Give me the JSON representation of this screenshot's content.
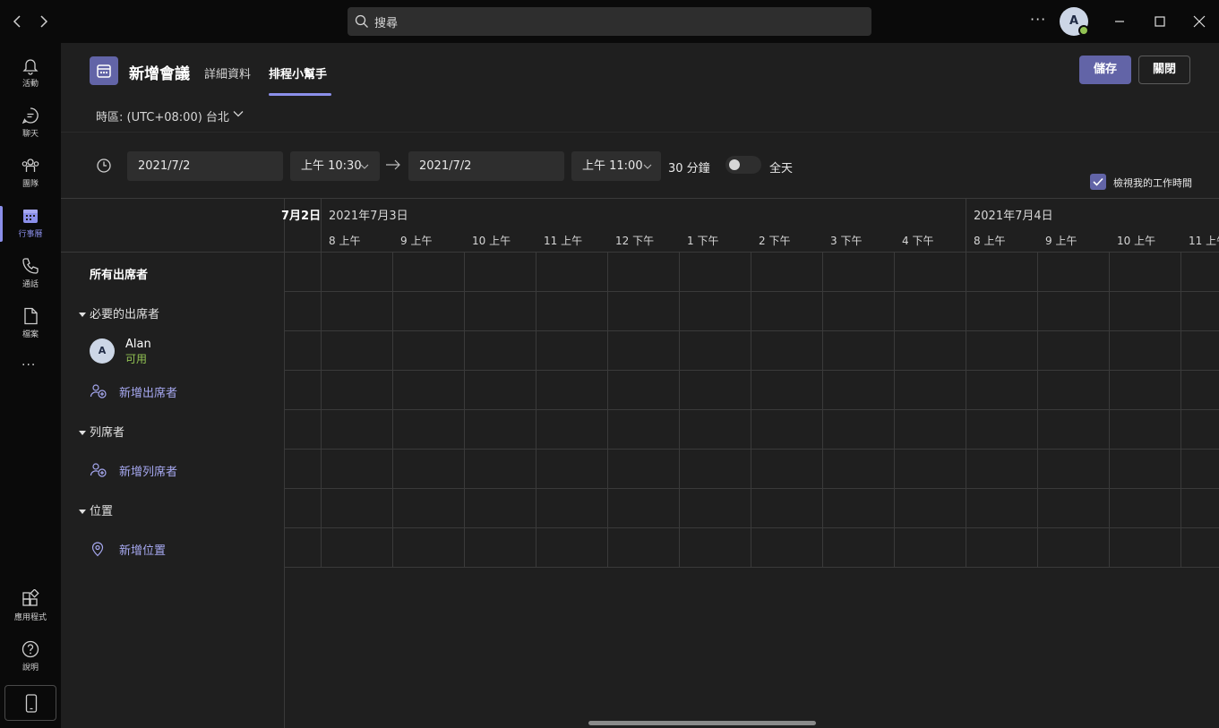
{
  "titlebar": {
    "back_icon": "chevron-left-icon",
    "forward_icon": "chevron-right-icon",
    "search_placeholder": "搜尋",
    "more_label": "···",
    "user_initial": "A"
  },
  "rail": {
    "items": [
      {
        "label": "活動",
        "icon": "bell-icon"
      },
      {
        "label": "聊天",
        "icon": "chat-icon"
      },
      {
        "label": "團隊",
        "icon": "teams-icon"
      },
      {
        "label": "行事曆",
        "icon": "calendar-icon",
        "active": true
      },
      {
        "label": "通話",
        "icon": "phone-icon"
      },
      {
        "label": "檔案",
        "icon": "file-icon"
      }
    ],
    "more": "···",
    "bottom": [
      {
        "label": "應用程式",
        "icon": "apps-icon"
      },
      {
        "label": "說明",
        "icon": "help-icon"
      }
    ]
  },
  "header": {
    "title": "新增會議",
    "tabs": [
      {
        "label": "詳細資料",
        "active": false
      },
      {
        "label": "排程小幫手",
        "active": true
      }
    ],
    "save_label": "儲存",
    "close_label": "關閉",
    "timezone": "時區: (UTC+08:00) 台北"
  },
  "time_row": {
    "start_date": "2021/7/2",
    "start_time": "上午 10:30",
    "end_date": "2021/7/2",
    "end_time": "上午 11:00",
    "duration": "30 分鐘",
    "all_day_label": "全天",
    "all_day_on": false,
    "work_hours_label": "檢視我的工作時間",
    "work_hours_checked": true
  },
  "attendees": {
    "all_label": "所有出席者",
    "required_section": "必要的出席者",
    "people": [
      {
        "initial": "A",
        "name": "Alan",
        "status": "可用"
      }
    ],
    "add_attendee": "新增出席者",
    "optional_section": "列席者",
    "add_optional": "新增列席者",
    "location_section": "位置",
    "add_location": "新增位置"
  },
  "schedule": {
    "partial_date": "7月2日",
    "dates": [
      "2021年7月3日",
      "2021年7月4日"
    ],
    "day1_hours": [
      "8 上午",
      "9 上午",
      "10 上午",
      "11 上午",
      "12 下午",
      "1 下午",
      "2 下午",
      "3 下午",
      "4 下午"
    ],
    "day2_hours": [
      "8 上午",
      "9 上午",
      "10 上午",
      "11 上午"
    ]
  },
  "colors": {
    "accent": "#6264a7",
    "accent_light": "#8b8fea",
    "available": "#92c353",
    "background": "#1f1f1f",
    "rail": "#0a0a0a"
  }
}
